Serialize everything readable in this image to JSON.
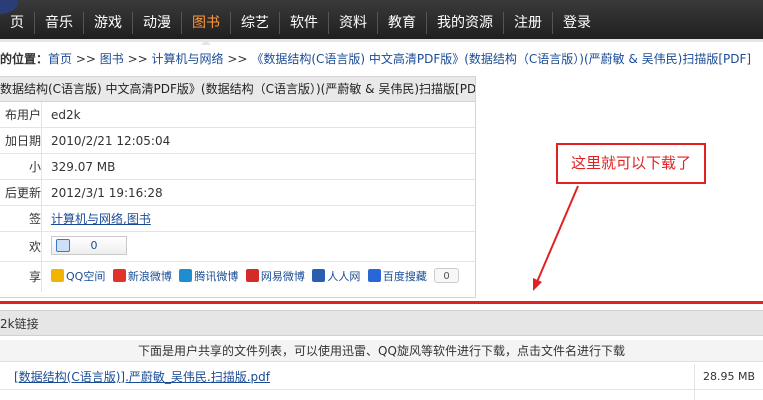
{
  "nav": {
    "items": [
      {
        "label": "页"
      },
      {
        "label": "音乐"
      },
      {
        "label": "游戏"
      },
      {
        "label": "动漫"
      },
      {
        "label": "图书"
      },
      {
        "label": "综艺"
      },
      {
        "label": "软件"
      },
      {
        "label": "资料"
      },
      {
        "label": "教育"
      },
      {
        "label": "我的资源"
      },
      {
        "label": "注册"
      },
      {
        "label": "登录"
      }
    ],
    "active_index": 4
  },
  "breadcrumb": {
    "prefix": "的位置：",
    "sep": " >> ",
    "home": "首页",
    "books": "图书",
    "category": "计算机与网络",
    "current": "《数据结构(C语言版) 中文高清PDF版》(数据结构（C语言版）)(严蔚敏 & 吴伟民)扫描版[PDF]"
  },
  "info": {
    "title": "数据结构(C语言版) 中文高清PDF版》(数据结构（C语言版）)(严蔚敏 & 吴伟民)扫描版[PDF]",
    "rows": [
      {
        "label": "布用户",
        "value": "ed2k"
      },
      {
        "label": "加日期",
        "value": "2010/2/21 12:05:04"
      },
      {
        "label": "小",
        "value": "329.07 MB"
      },
      {
        "label": "后更新",
        "value": "2012/3/1 19:16:28"
      },
      {
        "label": "签",
        "value": "计算机与网络,图书"
      }
    ],
    "like_label": "欢",
    "like_count": "0",
    "share_label": "享",
    "share_items": [
      {
        "label": "QQ空间",
        "color": "#f2b400"
      },
      {
        "label": "新浪微博",
        "color": "#e2322a"
      },
      {
        "label": "腾讯微博",
        "color": "#1d8fd0"
      },
      {
        "label": "网易微博",
        "color": "#d32a2a"
      },
      {
        "label": "人人网",
        "color": "#2a5fb0"
      },
      {
        "label": "百度搜藏",
        "color": "#2b66d6"
      }
    ],
    "share_count": "0"
  },
  "annotation": {
    "text": "这里就可以下载了",
    "color": "#e02222"
  },
  "ed2k": {
    "header": "2k链接",
    "note": "下面是用户共享的文件列表，可以使用迅雷、QQ旋风等软件进行下载，点击文件名进行下载",
    "files": [
      {
        "name": "[数据结构(C语言版)].严蔚敏_吴伟民.扫描版.pdf",
        "size": "28.95 MB"
      },
      {
        "name": "",
        "size": ""
      }
    ]
  },
  "colors": {
    "nav_bg": "#2b2b2b",
    "nav_active": "#ff9a3a",
    "link": "#1a4c96",
    "accent_red": "#e02222"
  }
}
